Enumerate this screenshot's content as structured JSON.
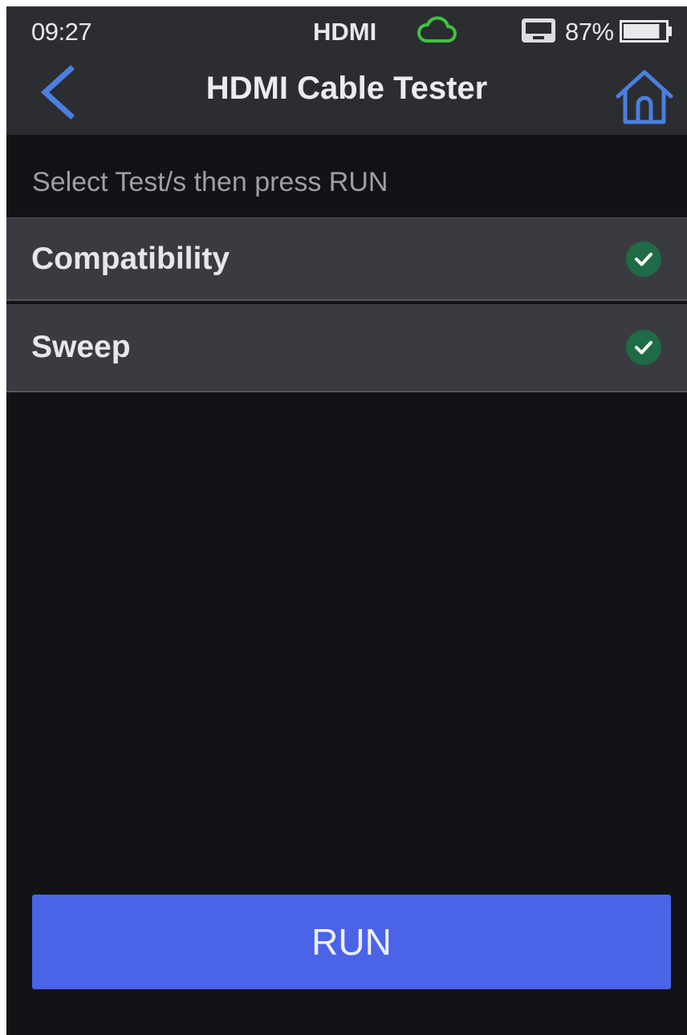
{
  "status_bar": {
    "time": "09:27",
    "mode": "HDMI",
    "battery_percent": "87%",
    "battery_level": 0.87,
    "cloud_icon": "cloud-icon",
    "monitor_icon": "monitor-icon",
    "colors": {
      "cloud": "#3fc33f"
    }
  },
  "header": {
    "title": "HDMI Cable Tester",
    "back_icon": "chevron-left-icon",
    "home_icon": "home-icon",
    "accent": "#4a7fe0"
  },
  "instruction": "Select Test/s then press RUN",
  "tests": [
    {
      "label": "Compatibility",
      "checked": true
    },
    {
      "label": "Sweep",
      "checked": true
    }
  ],
  "run_button": {
    "label": "RUN",
    "color": "#4a63e7"
  }
}
